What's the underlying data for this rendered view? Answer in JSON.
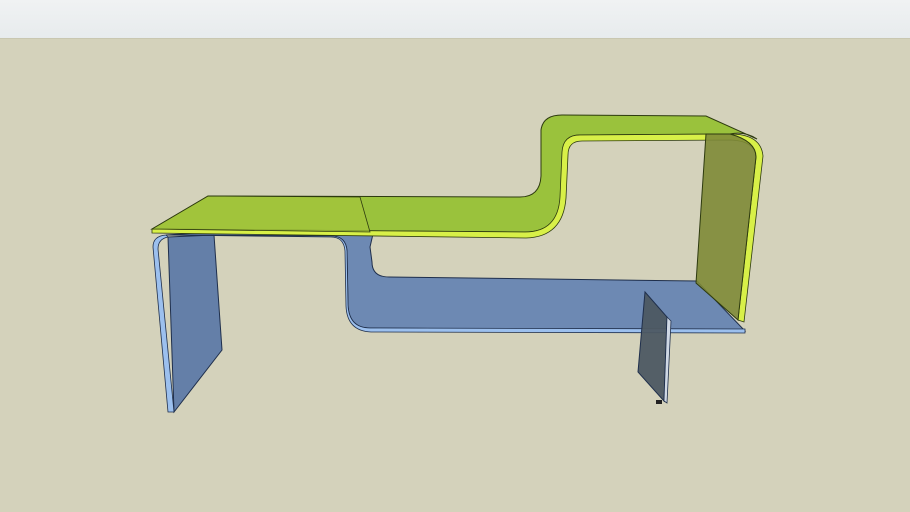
{
  "viewport": {
    "sky_color": "#eaeef0",
    "ground_color": "#d4d2bb"
  },
  "model": {
    "green_shelf": {
      "fill": "#93c02f",
      "edge": "#d8f048",
      "outline": "#2d3a0f"
    },
    "blue_shelf": {
      "fill": "#5f7eb2",
      "edge": "#9cc0ee",
      "outline": "#1f2f4c"
    }
  }
}
